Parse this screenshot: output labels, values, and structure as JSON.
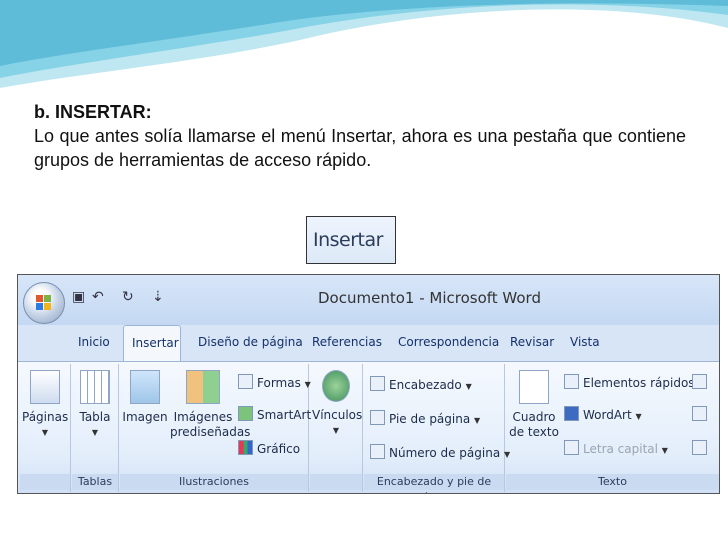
{
  "slide": {
    "heading": "b. INSERTAR:",
    "paragraph": "Lo que antes solía llamarse el menú Insertar, ahora es una pestaña que contiene grupos de herramientas de acceso rápido.",
    "tab_image_label": "Insertar"
  },
  "word": {
    "title": "Documento1 - Microsoft Word",
    "tabs": [
      "Inicio",
      "Insertar",
      "Diseño de página",
      "Referencias",
      "Correspondencia",
      "Revisar",
      "Vista"
    ],
    "groups": {
      "paginas": {
        "button": "Páginas",
        "label": ""
      },
      "tablas": {
        "button": "Tabla",
        "label": "Tablas"
      },
      "ilustraciones": {
        "label": "Ilustraciones",
        "imagen": "Imagen",
        "imagenes_line1": "Imágenes",
        "imagenes_line2": "prediseñadas",
        "formas": "Formas",
        "smartart": "SmartArt",
        "grafico": "Gráfico"
      },
      "vinculos": {
        "button": "Vínculos",
        "label": ""
      },
      "encabezado": {
        "label": "Encabezado y pie de página",
        "encabezado": "Encabezado",
        "pie": "Pie de página",
        "numero": "Número de página"
      },
      "texto": {
        "label": "Texto",
        "cuadro_line1": "Cuadro",
        "cuadro_line2": "de texto",
        "elementos": "Elementos rápidos",
        "wordart": "WordArt",
        "letra": "Letra capital"
      }
    }
  },
  "colors": {
    "wave": "#7fd0e6",
    "ribbon": "#dfeaf8",
    "tab_text": "#15316b"
  }
}
